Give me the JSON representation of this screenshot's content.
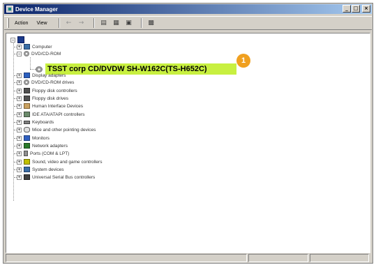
{
  "window": {
    "title": "Device Manager"
  },
  "title_buttons": {
    "minimize": "_",
    "maximize": "□",
    "close": "×"
  },
  "menubar": {
    "items": [
      "Action",
      "View"
    ]
  },
  "toolbar": {
    "icons": [
      "back-icon",
      "forward-icon",
      "view-icon",
      "properties-icon",
      "help-icon",
      "scan-icon"
    ]
  },
  "tree": {
    "root_label": "",
    "items": [
      {
        "label": "Computer",
        "icon": "computer-icon",
        "expanded": false
      },
      {
        "label": "DVD/CD-ROM",
        "icon": "disc-icon",
        "expanded": true
      },
      {
        "label": "Display adapters",
        "icon": "display-icon",
        "expanded": false
      },
      {
        "label": "DVD/CD-ROM drives",
        "icon": "disc-icon",
        "expanded": false
      },
      {
        "label": "Floppy disk controllers",
        "icon": "floppy-icon",
        "expanded": false
      },
      {
        "label": "Floppy disk drives",
        "icon": "floppy-icon",
        "expanded": false
      },
      {
        "label": "Human Interface Devices",
        "icon": "hid-icon",
        "expanded": false
      },
      {
        "label": "IDE ATA/ATAPI controllers",
        "icon": "ide-icon",
        "expanded": false
      },
      {
        "label": "Keyboards",
        "icon": "keyboard-icon",
        "expanded": false
      },
      {
        "label": "Mice and other pointing devices",
        "icon": "mouse-icon",
        "expanded": false
      },
      {
        "label": "Monitors",
        "icon": "monitor-icon",
        "expanded": false
      },
      {
        "label": "Network adapters",
        "icon": "network-icon",
        "expanded": false
      },
      {
        "label": "Ports (COM & LPT)",
        "icon": "port-icon",
        "expanded": false
      },
      {
        "label": "Sound, video and game controllers",
        "icon": "sound-icon",
        "expanded": false
      },
      {
        "label": "System devices",
        "icon": "system-icon",
        "expanded": false
      },
      {
        "label": "Universal Serial Bus controllers",
        "icon": "usb-icon",
        "expanded": false
      }
    ],
    "highlighted_device": "TSST corp CD/DVDW SH-W162C(TS-H652C)",
    "expander_plus": "+",
    "expander_minus": "−"
  },
  "callout": {
    "number": "1",
    "color": "#f0a020"
  },
  "colors": {
    "highlight": "#c8f040",
    "titlebar_start": "#0a246a",
    "titlebar_end": "#a6caf0"
  }
}
